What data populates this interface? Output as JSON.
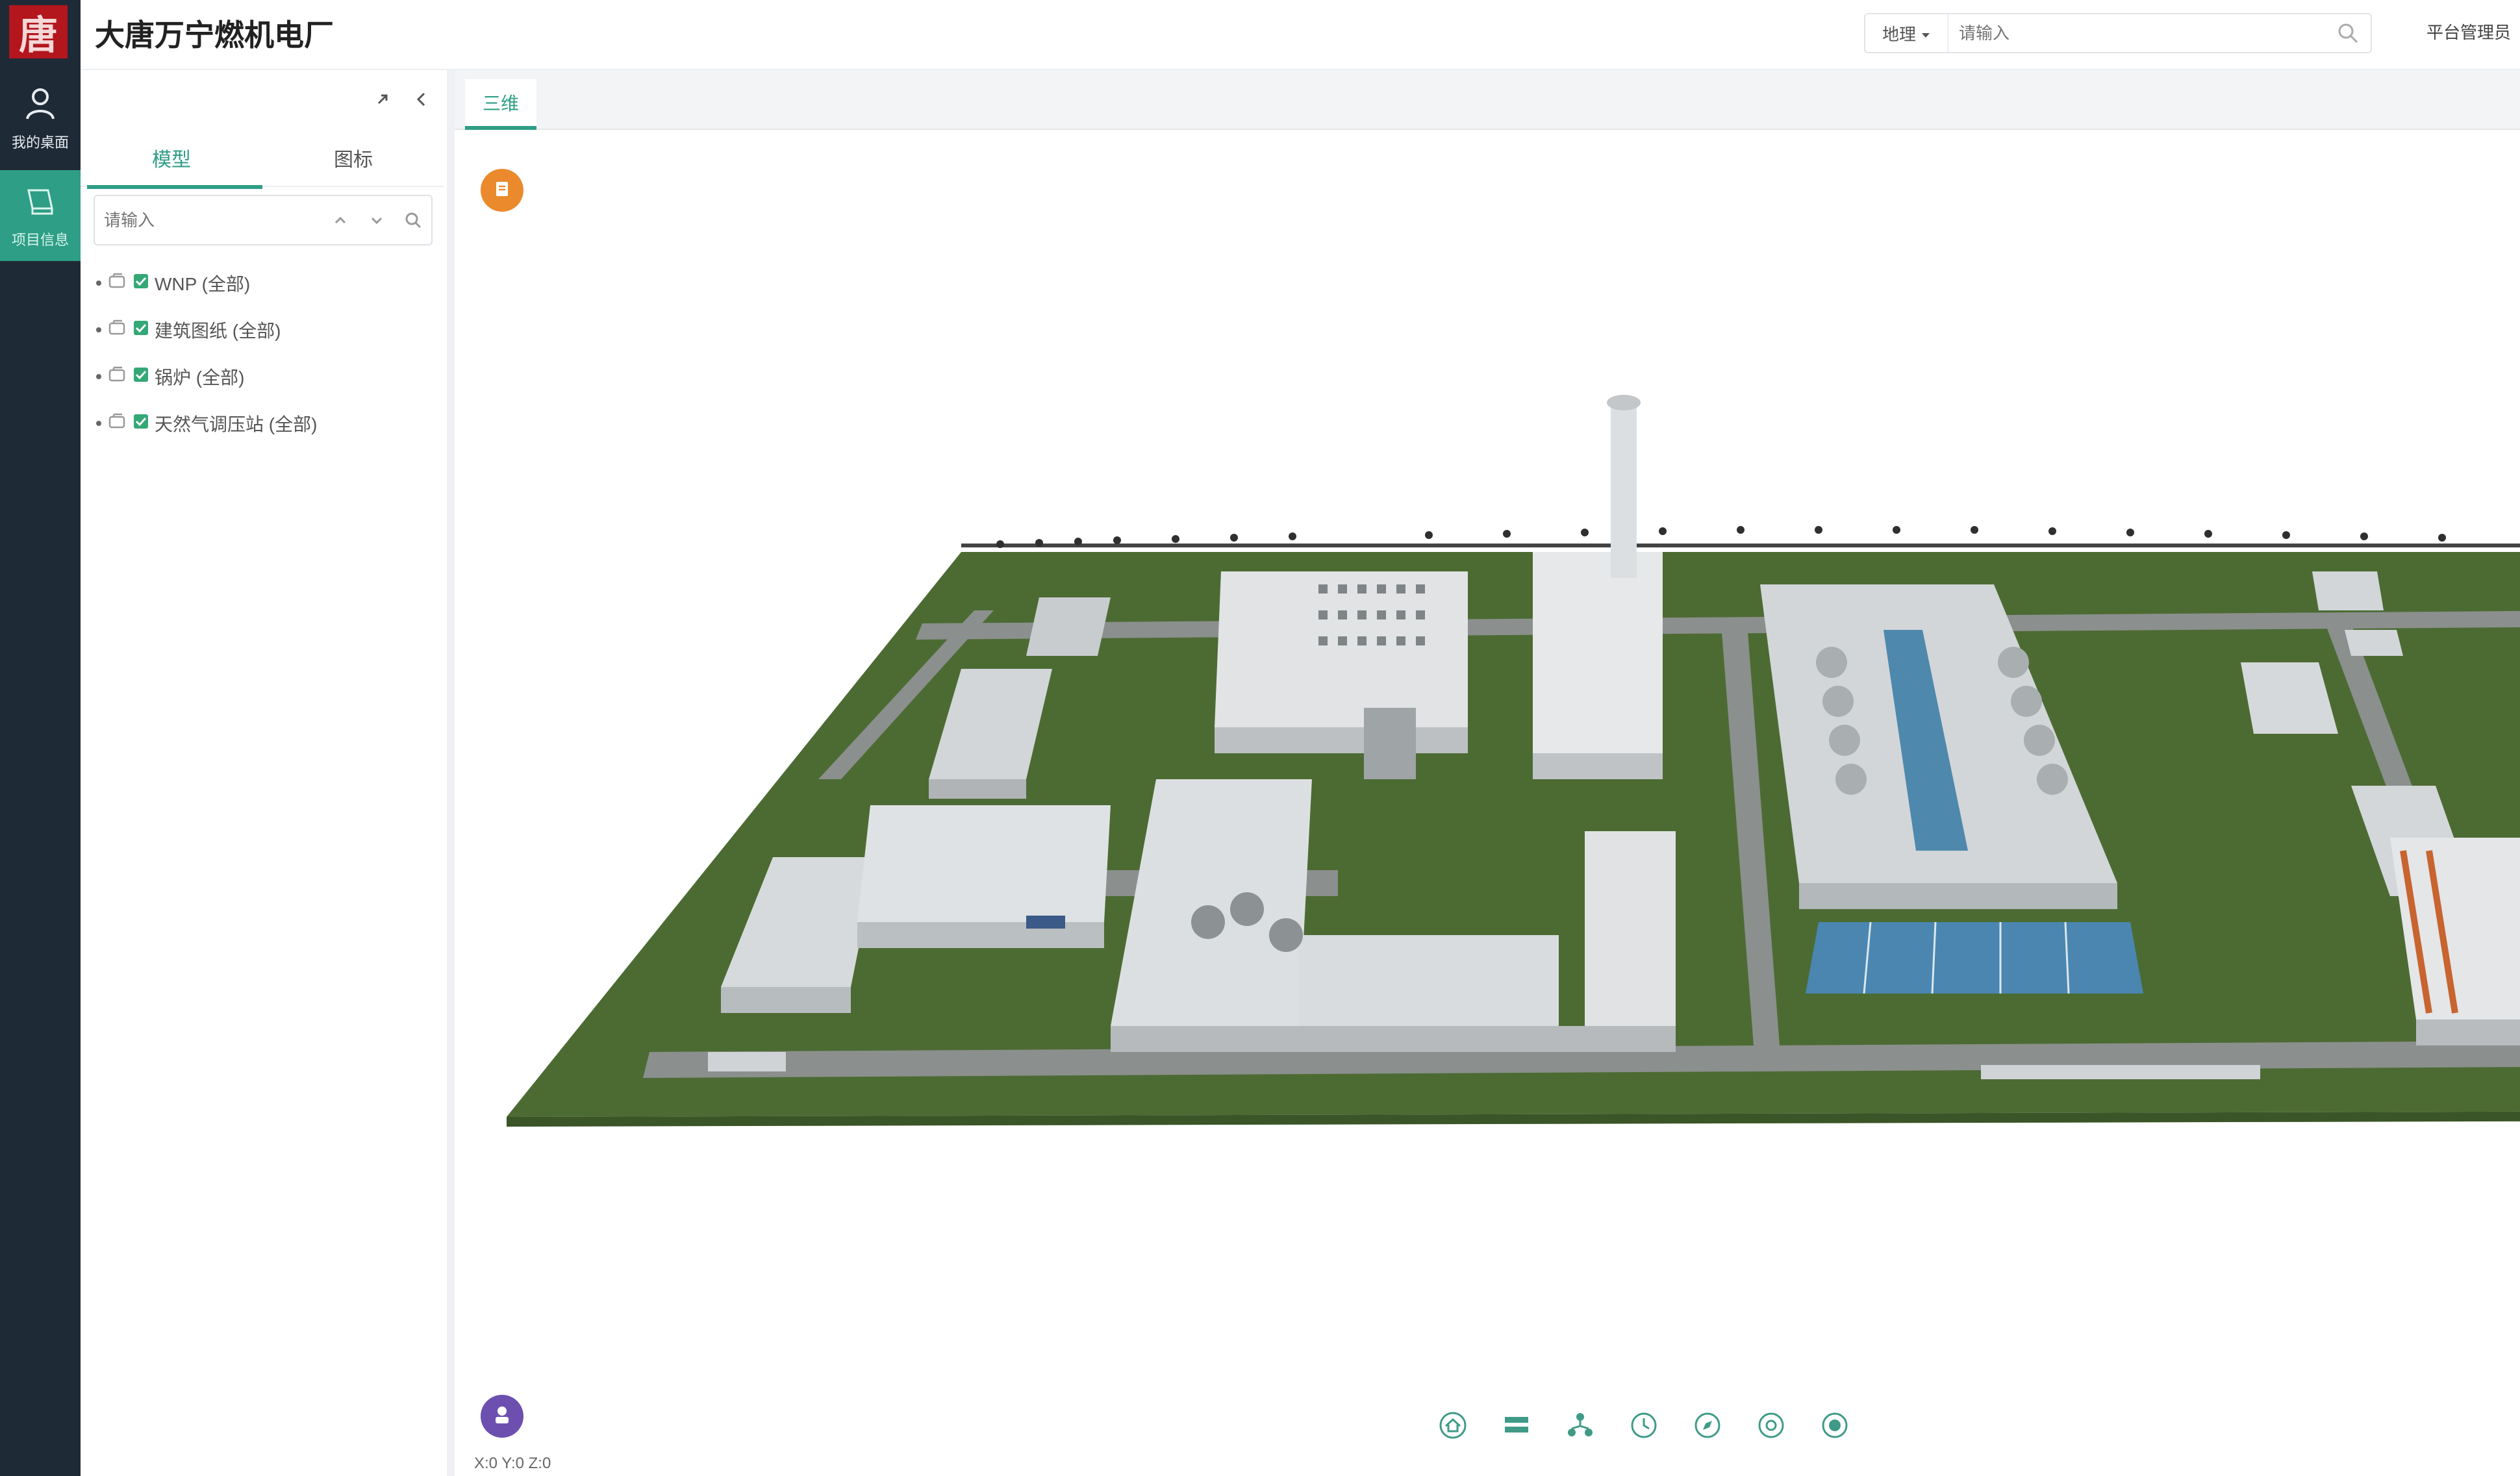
{
  "app": {
    "title": "大唐万宁燃机电厂",
    "user": "平台管理员"
  },
  "rail": {
    "items": [
      {
        "label": "我的桌面",
        "icon": "user-icon"
      },
      {
        "label": "项目信息",
        "icon": "model-icon"
      }
    ]
  },
  "search": {
    "scope": "地理",
    "placeholder": "请输入"
  },
  "panel": {
    "tabs": [
      {
        "label": "模型"
      },
      {
        "label": "图标"
      }
    ],
    "search_placeholder": "请输入",
    "tree": [
      {
        "label": "WNP (全部)"
      },
      {
        "label": "建筑图纸 (全部)"
      },
      {
        "label": "锅炉 (全部)"
      },
      {
        "label": "天然气调压站 (全部)"
      }
    ]
  },
  "viewer": {
    "tab": "三维",
    "coords": "X:0 Y:0 Z:0",
    "toolbar": [
      "home-icon",
      "layers-icon",
      "tree-icon",
      "clock-icon",
      "compass-icon",
      "settings-icon",
      "fullscreen-icon"
    ]
  },
  "colors": {
    "accent": "#2e9e86",
    "rail": "#1f2a37",
    "logo": "#b3161d",
    "grass": "#4c6b33",
    "building": "#d9dcde",
    "water": "#4f88ad"
  }
}
